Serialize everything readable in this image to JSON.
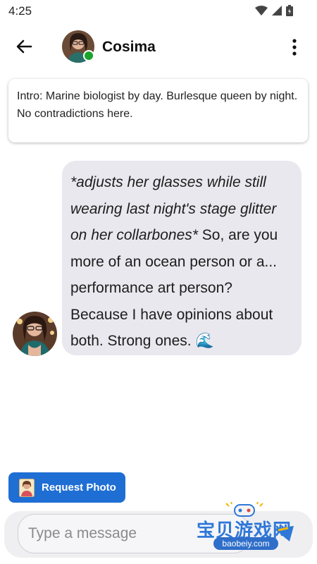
{
  "status_bar": {
    "time": "4:25",
    "icons": [
      "wifi-icon",
      "signal-icon",
      "battery-icon"
    ]
  },
  "header": {
    "back_icon": "arrow-left-icon",
    "contact_name": "Cosima",
    "online": true,
    "menu_icon": "more-vertical-icon"
  },
  "intro": {
    "text": "Intro: Marine biologist by day. Burlesque queen by night. No contradictions here."
  },
  "messages": [
    {
      "sender": "Cosima",
      "action": "*adjusts her glasses while still wearing last night's stage glitter on her collarbones*",
      "text": " So, are you more of an ocean person or a... performance art person? Because I have opinions about both. Strong ones. 🌊"
    }
  ],
  "request_photo": {
    "label": "Request Photo",
    "icon": "portrait-icon"
  },
  "composer": {
    "placeholder": "Type a message",
    "value": ""
  },
  "watermark": {
    "text": "宝贝游戏网",
    "url": "baobeiy.com"
  },
  "colors": {
    "accent": "#1f6ed4",
    "bubble": "#e8e8ee",
    "online": "#19a52b",
    "composer_bg": "#efeff2"
  }
}
